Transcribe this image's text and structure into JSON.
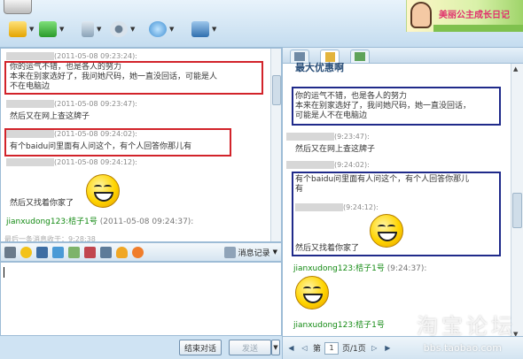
{
  "toolbar": {
    "banner_text": "美丽公主成长日记"
  },
  "left_chat": {
    "messages": [
      {
        "time": "(2011-05-08 09:23:24):",
        "text_1": "你的运气不错，也是各人的努力",
        "text_2": "本来在别家选好了，我问她尺码，她一直没回话，可能是人",
        "text_3": "不在电脑边"
      },
      {
        "time": "(2011-05-08 09:23:47):",
        "text_1": "然后又在网上查这牌子"
      },
      {
        "time": "(2011-05-08 09:24:02):",
        "text_1": "有个baidu问里面有人问这个，有个人回答你那儿有"
      },
      {
        "time": "(2011-05-08 09:24:12):",
        "text_1": "然后又找着你家了"
      },
      {
        "sender": "jianxudong123:桔子1号",
        "time": "(2011-05-08 09:24:37):"
      }
    ],
    "footnote": "最后一条消息收于：9:28:38"
  },
  "format_bar": {
    "history_label": "消息记录"
  },
  "bottom_bar": {
    "end_label": "结束对话",
    "send_label": "发送"
  },
  "right_panel": {
    "title": "最大优惠啊",
    "messages": [
      {
        "text_1": "你的运气不错，也是各人的努力",
        "text_2": "本来在别家选好了，我问她尺码，她一直没回话，",
        "text_3": "可能是人不在电脑边"
      },
      {
        "time": "(9:23:47):",
        "text_1": "然后又在网上查这牌子"
      },
      {
        "time": "(9:24:02):",
        "text_1": "有个baidu问里面有人问这个，有个人回答你那儿",
        "text_2": "有"
      },
      {
        "time": "(9:24:12):",
        "text_1": "然后又找着你家了"
      },
      {
        "sender": "jianxudong123:桔子1号",
        "time": "(9:24:37):"
      }
    ],
    "pager": {
      "prefix": "第",
      "page": "1",
      "suffix": "页/1页"
    }
  },
  "watermark": {
    "main": "淘宝论坛",
    "url": "bbs.taobao.com"
  },
  "colors": {
    "highlight_red": "#d2232a",
    "highlight_blue": "#1f2a8a",
    "sender_green": "#138a13"
  }
}
